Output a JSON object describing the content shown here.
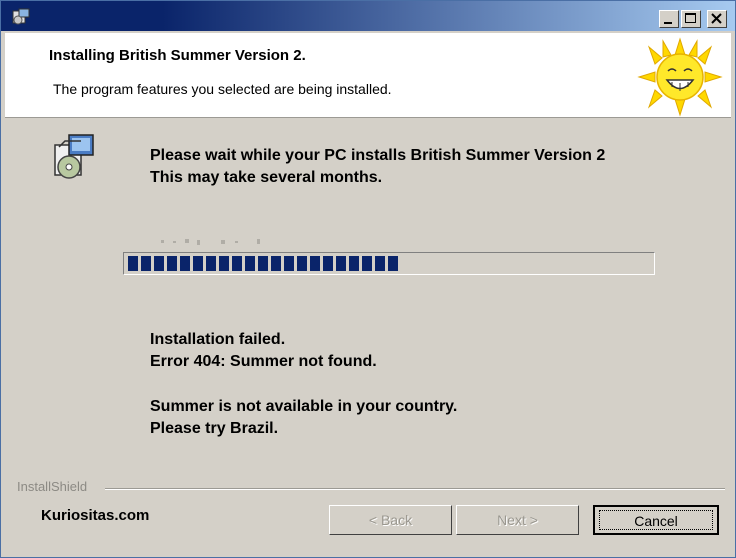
{
  "window": {
    "header_title": "Installing British Summer Version 2.",
    "header_subtitle": "The program features you selected are being installed."
  },
  "icons": {
    "app": "setup-icon",
    "header_graphic": "smiling-sun-icon",
    "setup": "setup-box-icon",
    "minimize": "minimize-icon",
    "maximize": "maximize-icon",
    "close": "close-icon"
  },
  "body": {
    "line1": "Please wait while your PC installs British Summer Version 2",
    "line2": "This may take several months.",
    "error_line1": "Installation failed.",
    "error_line2": "Error 404: Summer not found.",
    "note_line1": "Summer is not available in your country.",
    "note_line2": "Please try Brazil."
  },
  "progress": {
    "fraction": 0.52,
    "color": "#0a246a"
  },
  "footer": {
    "installshield_label": "InstallShield",
    "brand": "Kuriositas.com",
    "back_label": "< Back",
    "next_label": "Next >",
    "cancel_label": "Cancel"
  }
}
